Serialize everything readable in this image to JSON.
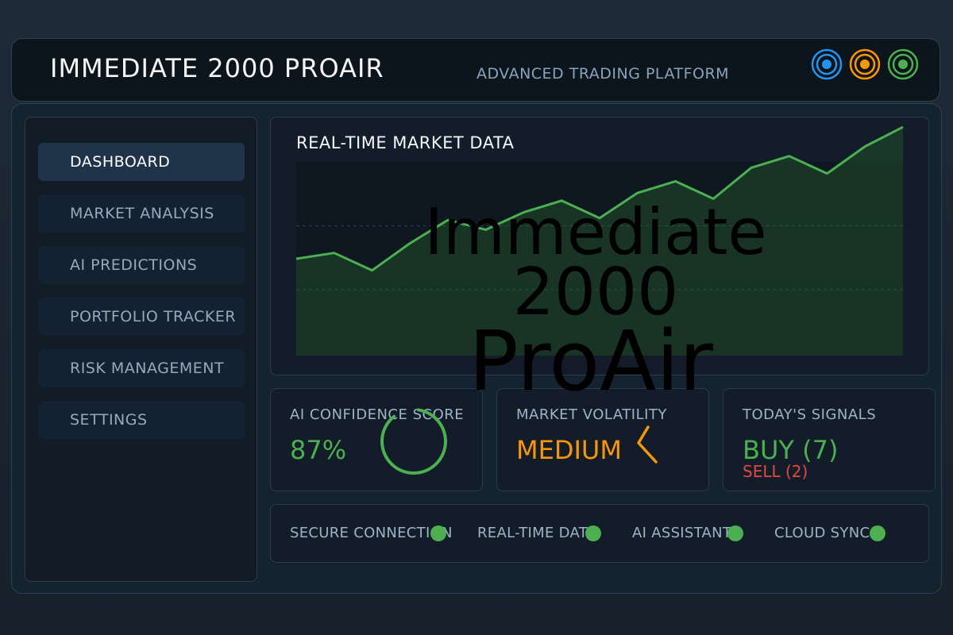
{
  "header": {
    "title": "IMMEDIATE 2000 PROAIR",
    "subtitle": "ADVANCED TRADING PLATFORM",
    "status_icons": [
      {
        "name": "blue-ring-icon",
        "color": "#2196f3"
      },
      {
        "name": "orange-ring-icon",
        "color": "#ff9800"
      },
      {
        "name": "green-ring-icon",
        "color": "#4caf50"
      }
    ]
  },
  "sidebar": {
    "items": [
      {
        "label": "DASHBOARD",
        "active": true
      },
      {
        "label": "MARKET ANALYSIS",
        "active": false
      },
      {
        "label": "AI PREDICTIONS",
        "active": false
      },
      {
        "label": "PORTFOLIO TRACKER",
        "active": false
      },
      {
        "label": "RISK MANAGEMENT",
        "active": false
      },
      {
        "label": "SETTINGS",
        "active": false
      }
    ]
  },
  "chart": {
    "title": "REAL-TIME MARKET DATA"
  },
  "chart_data": {
    "type": "area",
    "title": "REAL-TIME MARKET DATA",
    "xlabel": "",
    "ylabel": "",
    "ylim": [
      0,
      100
    ],
    "grid": true,
    "x": [
      0,
      1,
      2,
      3,
      4,
      5,
      6,
      7,
      8,
      9,
      10,
      11,
      12,
      13,
      14,
      15,
      16
    ],
    "series": [
      {
        "values": [
          50,
          53,
          44,
          58,
          70,
          65,
          74,
          80,
          71,
          84,
          90,
          81,
          97,
          103,
          94,
          108,
          118
        ],
        "color": "#4caf50"
      }
    ]
  },
  "cards": {
    "confidence": {
      "label": "AI CONFIDENCE SCORE",
      "value": "87%",
      "color": "#4caf50",
      "gauge_fraction": 0.87
    },
    "volatility": {
      "label": "MARKET VOLATILITY",
      "value": "MEDIUM",
      "color": "#ff9800"
    },
    "signals": {
      "label": "TODAY'S SIGNALS",
      "buy": "BUY (7)",
      "sell": "SELL (2)",
      "buy_color": "#4caf50",
      "sell_color": "#e04a42"
    }
  },
  "status_bar": [
    {
      "label": "SECURE CONNECTION",
      "color": "#4caf50"
    },
    {
      "label": "REAL-TIME DATA",
      "color": "#4caf50"
    },
    {
      "label": "AI ASSISTANT",
      "color": "#4caf50"
    },
    {
      "label": "CLOUD SYNC",
      "color": "#4caf50"
    }
  ],
  "watermark": {
    "line1": "Immediate",
    "line2": "2000",
    "line3": "ProAir"
  }
}
